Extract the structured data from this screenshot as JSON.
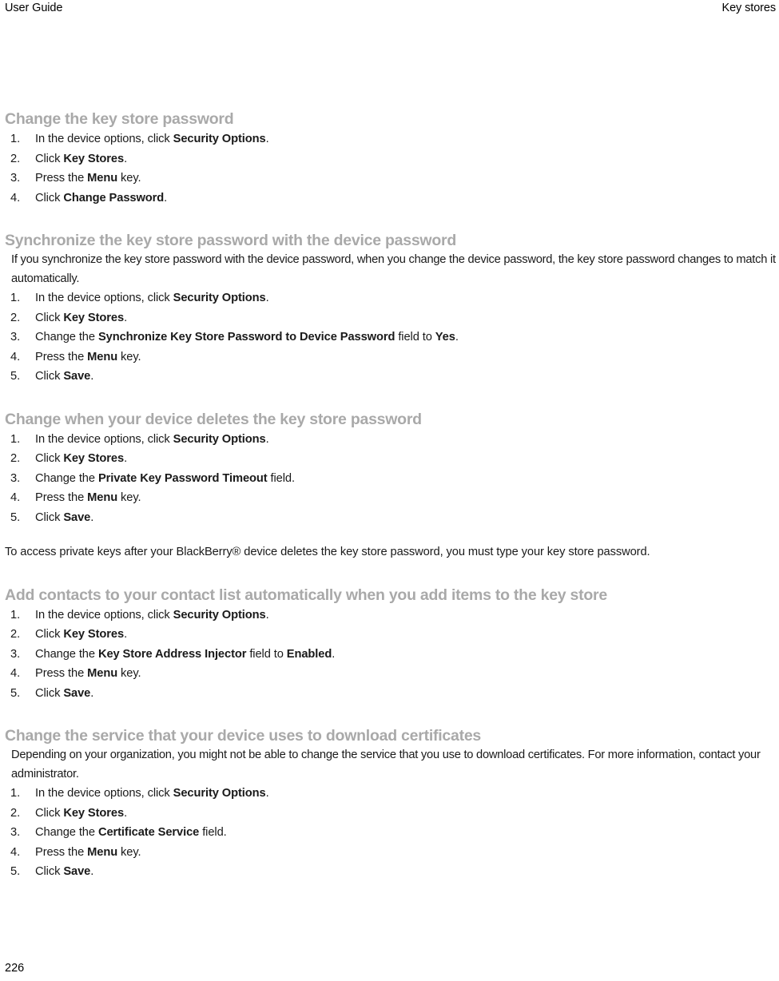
{
  "header": {
    "left": "User Guide",
    "right": "Key stores"
  },
  "footer": {
    "page_number": "226"
  },
  "sections": [
    {
      "heading": "Change the key store password",
      "intro": null,
      "steps": [
        {
          "pre": "In the device options, click ",
          "bold": "Security Options",
          "post": "."
        },
        {
          "pre": "Click ",
          "bold": "Key Stores",
          "post": "."
        },
        {
          "pre": "Press the ",
          "bold": "Menu",
          "post": " key."
        },
        {
          "pre": "Click ",
          "bold": "Change Password",
          "post": "."
        }
      ],
      "note": null
    },
    {
      "heading": "Synchronize the key store password with the device password",
      "intro": "If you synchronize the key store password with the device password, when you change the device password, the key store password changes to match it automatically.",
      "steps": [
        {
          "pre": "In the device options, click ",
          "bold": "Security Options",
          "post": "."
        },
        {
          "pre": "Click ",
          "bold": "Key Stores",
          "post": "."
        },
        {
          "pre": "Change the ",
          "bold": "Synchronize Key Store Password to Device Password",
          "mid": " field to ",
          "bold2": "Yes",
          "post": "."
        },
        {
          "pre": "Press the ",
          "bold": "Menu",
          "post": " key."
        },
        {
          "pre": "Click ",
          "bold": "Save",
          "post": "."
        }
      ],
      "note": null
    },
    {
      "heading": "Change when your device deletes the key store password",
      "intro": null,
      "steps": [
        {
          "pre": "In the device options, click ",
          "bold": "Security Options",
          "post": "."
        },
        {
          "pre": "Click ",
          "bold": "Key Stores",
          "post": "."
        },
        {
          "pre": "Change the ",
          "bold": "Private Key Password Timeout",
          "post": " field."
        },
        {
          "pre": "Press the ",
          "bold": "Menu",
          "post": " key."
        },
        {
          "pre": "Click ",
          "bold": "Save",
          "post": "."
        }
      ],
      "note": "To access private keys after your BlackBerry® device deletes the key store password, you must type your key store password."
    },
    {
      "heading": "Add contacts to your contact list automatically when you add items to the key store",
      "intro": null,
      "steps": [
        {
          "pre": "In the device options, click ",
          "bold": "Security Options",
          "post": "."
        },
        {
          "pre": "Click ",
          "bold": "Key Stores",
          "post": "."
        },
        {
          "pre": "Change the ",
          "bold": "Key Store Address Injector",
          "mid": " field to ",
          "bold2": "Enabled",
          "post": "."
        },
        {
          "pre": "Press the ",
          "bold": "Menu",
          "post": " key."
        },
        {
          "pre": "Click ",
          "bold": "Save",
          "post": "."
        }
      ],
      "note": null
    },
    {
      "heading": "Change the service that your device uses to download certificates",
      "intro": "Depending on your organization, you might not be able to change the service that you use to download certificates. For more information, contact your administrator.",
      "steps": [
        {
          "pre": "In the device options, click ",
          "bold": "Security Options",
          "post": "."
        },
        {
          "pre": "Click ",
          "bold": "Key Stores",
          "post": "."
        },
        {
          "pre": "Change the ",
          "bold": "Certificate Service",
          "post": " field."
        },
        {
          "pre": "Press the ",
          "bold": "Menu",
          "post": " key."
        },
        {
          "pre": "Click ",
          "bold": "Save",
          "post": "."
        }
      ],
      "note": null
    }
  ],
  "colors": {
    "heading": "#a9a9a9",
    "body_text": "#1a1a1a",
    "background": "#ffffff"
  }
}
